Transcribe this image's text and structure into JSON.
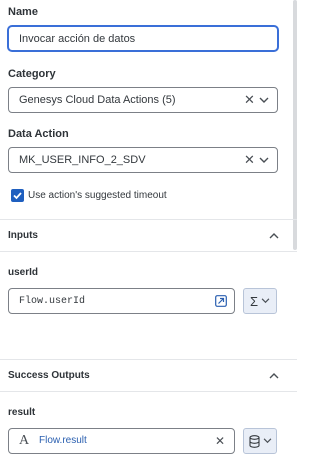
{
  "name": {
    "label": "Name",
    "value": "Invocar acción de datos"
  },
  "category": {
    "label": "Category",
    "value": "Genesys Cloud Data Actions (5)"
  },
  "data_action": {
    "label": "Data Action",
    "value": "MK_USER_INFO_2_SDV"
  },
  "timeout": {
    "label": "Use action's suggested timeout",
    "checked": true
  },
  "inputs": {
    "title": "Inputs",
    "field_label": "userId",
    "value": "Flow.userId",
    "expr_symbol": "Σ"
  },
  "success_outputs": {
    "title": "Success Outputs",
    "field_label": "result",
    "value": "Flow.result",
    "type_symbol": "A"
  },
  "colors": {
    "accent": "#3a6fd8",
    "link": "#2a5fb0",
    "checkbox": "#1f5fbf"
  },
  "icons": [
    "close-icon",
    "chevron-down-icon",
    "chevron-up-icon",
    "expand-icon",
    "sigma-icon",
    "database-icon",
    "text-type-icon",
    "checkbox-icon"
  ]
}
